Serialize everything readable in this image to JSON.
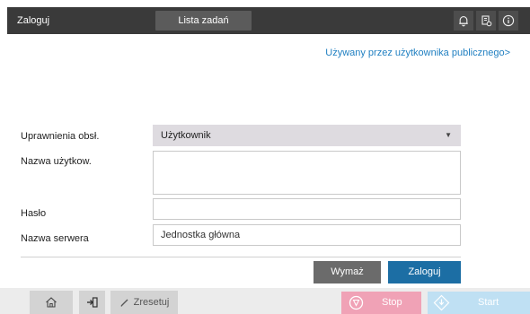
{
  "header": {
    "title": "Zaloguj",
    "job_list_tab": "Lista zadań",
    "icons": [
      "bell-icon",
      "device-status-icon",
      "info-icon"
    ]
  },
  "public_user_link": "Używany przez użytkownika publicznego>",
  "form": {
    "permission_label": "Uprawnienia obsł.",
    "permission_value": "Użytkownik",
    "username_label": "Nazwa użytkow.",
    "username_value": "",
    "password_label": "Hasło",
    "password_value": "",
    "server_label": "Nazwa serwera",
    "server_value": "Jednostka główna"
  },
  "actions": {
    "clear_label": "Wymaż",
    "login_label": "Zaloguj"
  },
  "footer": {
    "home_icon": "home-icon",
    "access_icon": "logout-icon",
    "reset_label": "Zresetuj",
    "stop_label": "Stop",
    "start_label": "Start"
  },
  "colors": {
    "header_bg": "#3a3a3a",
    "link": "#1f7fc1",
    "login_button": "#1c6ea4",
    "clear_button": "#6b6b6b",
    "stop_button": "#f0a2b6",
    "start_button": "#bfe0f3",
    "select_bg": "#dedbe0"
  }
}
